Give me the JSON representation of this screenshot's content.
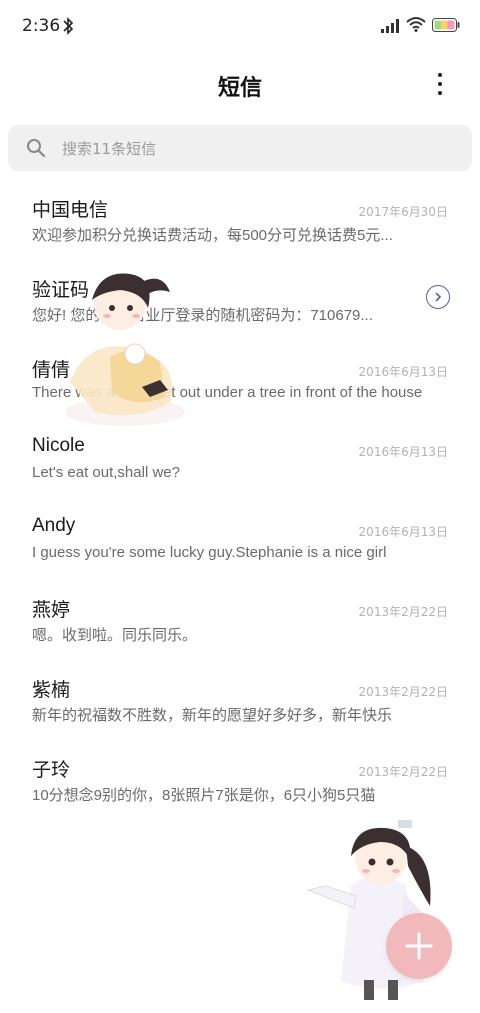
{
  "status_bar": {
    "time": "2:36",
    "icons": [
      "bluetooth-icon",
      "signal-icon",
      "wifi-icon",
      "battery-icon"
    ]
  },
  "header": {
    "title": "短信",
    "menu_icon": "more-vertical-icon"
  },
  "search": {
    "placeholder": "搜索11条短信",
    "icon": "search-icon"
  },
  "conversations": [
    {
      "name": "中国电信",
      "date": "2017年6月30日",
      "snippet": "欢迎参加积分兑换话费活动，每500分可兑换话费5元..."
    },
    {
      "name": "验证码",
      "date": "",
      "snippet": "您好! 您的网上营业厅登录的随机密码为：710679...",
      "action_icon": "chevron-right-circle-icon"
    },
    {
      "name": "倩倩",
      "date": "2016年6月13日",
      "snippet": "There was a table set out under a tree in front of the house"
    },
    {
      "name": "Nicole",
      "date": "2016年6月13日",
      "snippet": "Let's eat out,shall we?"
    },
    {
      "name": "Andy",
      "date": "2016年6月13日",
      "snippet": "I guess you're some lucky guy.Stephanie is a nice girl"
    },
    {
      "name": "燕婷",
      "date": "2013年2月22日",
      "snippet": "嗯。收到啦。同乐同乐。"
    },
    {
      "name": "紫楠",
      "date": "2013年2月22日",
      "snippet": "新年的祝福数不胜数，新年的愿望好多好多，新年快乐"
    },
    {
      "name": "子玲",
      "date": "2013年2月22日",
      "snippet": "10分想念9别的你，8张照片7张是你，6只小狗5只猫"
    }
  ],
  "fab": {
    "icon": "plus-icon"
  },
  "colors": {
    "fab_background": "#f2b9bd",
    "search_background": "#f0f0f0",
    "date_text": "#b3b3b3",
    "snippet_text": "#6a6a6a"
  }
}
